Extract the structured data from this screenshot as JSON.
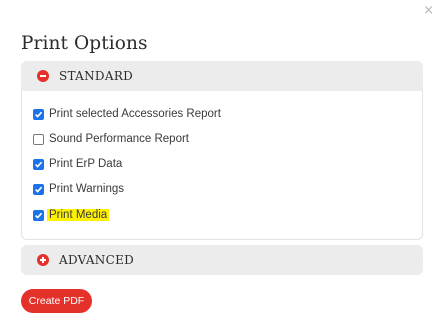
{
  "dialog": {
    "title": "Print Options",
    "close_glyph": "×"
  },
  "sections": {
    "standard": {
      "label": "STANDARD",
      "state": "expanded",
      "icon": "minus-circle-icon"
    },
    "advanced": {
      "label": "ADVANCED",
      "state": "collapsed",
      "icon": "plus-circle-icon"
    }
  },
  "options": [
    {
      "label": "Print selected Accessories Report",
      "checked": true,
      "highlighted": false
    },
    {
      "label": "Sound Performance Report",
      "checked": false,
      "highlighted": false
    },
    {
      "label": "Print ErP Data",
      "checked": true,
      "highlighted": false
    },
    {
      "label": "Print Warnings",
      "checked": true,
      "highlighted": false
    },
    {
      "label": "Print Media",
      "checked": true,
      "highlighted": true
    }
  ],
  "actions": {
    "create_pdf_label": "Create PDF"
  },
  "colors": {
    "accent": "#e4322b",
    "checkbox_checked": "#1a73e8",
    "highlight": "#fff200",
    "panel_header": "#ececec"
  }
}
